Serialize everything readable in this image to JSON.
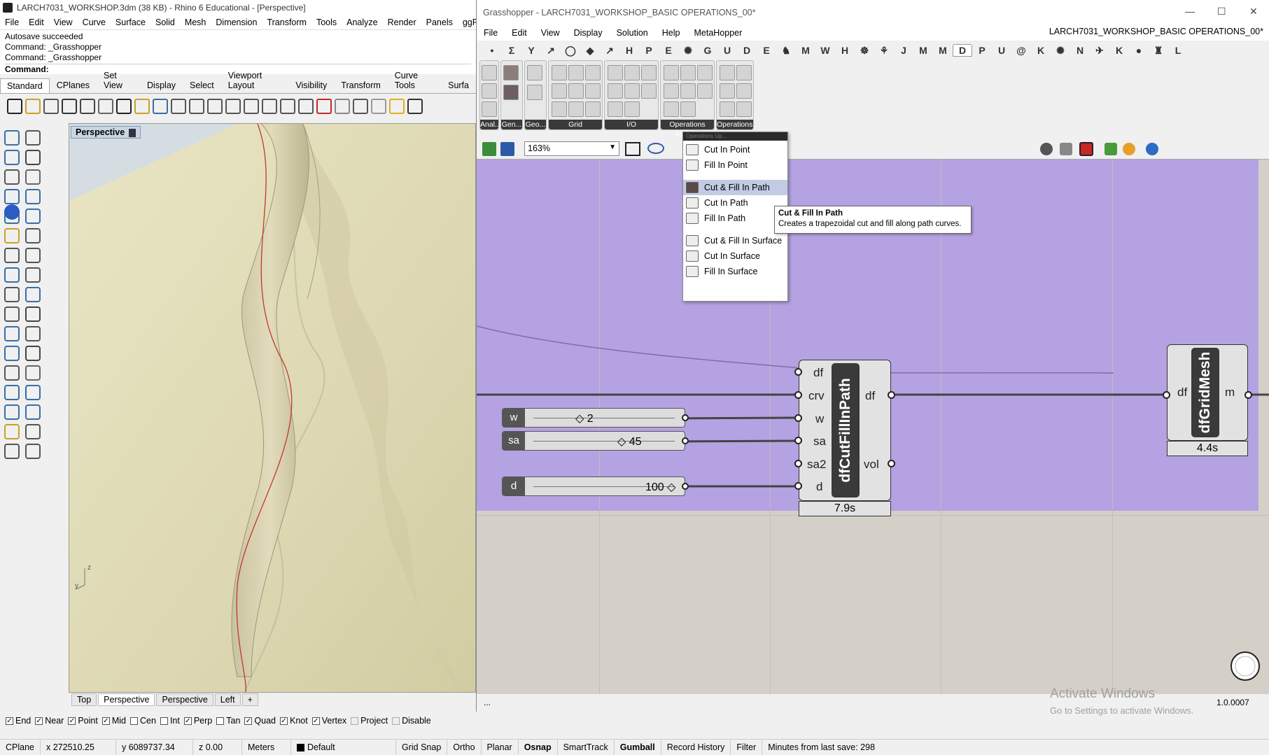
{
  "rhino": {
    "title": "LARCH7031_WORKSHOP.3dm (38 KB) - Rhino 6 Educational - [Perspective]",
    "menu": [
      "File",
      "Edit",
      "View",
      "Curve",
      "Surface",
      "Solid",
      "Mesh",
      "Dimension",
      "Transform",
      "Tools",
      "Analyze",
      "Render",
      "Panels",
      "ggRhinoIF"
    ],
    "command_history": [
      "Autosave succeeded",
      "Command: _Grasshopper",
      "Command: _Grasshopper"
    ],
    "command_prompt": "Command:",
    "toolbar_tabs": [
      "Standard",
      "CPlanes",
      "Set View",
      "Display",
      "Select",
      "Viewport Layout",
      "Visibility",
      "Transform",
      "Curve Tools",
      "Surfa"
    ],
    "active_toolbar_tab": "Standard",
    "viewport_name": "Perspective",
    "viewport_tabs": [
      "Top",
      "Perspective",
      "Perspective",
      "Left"
    ],
    "axis_labels": {
      "z": "z",
      "y": "y"
    },
    "osnaps": [
      {
        "label": "End",
        "checked": true
      },
      {
        "label": "Near",
        "checked": true
      },
      {
        "label": "Point",
        "checked": true
      },
      {
        "label": "Mid",
        "checked": true
      },
      {
        "label": "Cen",
        "checked": false
      },
      {
        "label": "Int",
        "checked": false
      },
      {
        "label": "Perp",
        "checked": true
      },
      {
        "label": "Tan",
        "checked": false
      },
      {
        "label": "Quad",
        "checked": true
      },
      {
        "label": "Knot",
        "checked": true
      },
      {
        "label": "Vertex",
        "checked": true
      },
      {
        "label": "Project",
        "checked": false
      },
      {
        "label": "Disable",
        "checked": false
      }
    ]
  },
  "status": {
    "cplane": "CPlane",
    "x": "x 272510.25",
    "y": "y 6089737.34",
    "z": "z 0.00",
    "units": "Meters",
    "layer": "Default",
    "toggles": [
      "Grid Snap",
      "Ortho",
      "Planar",
      "Osnap",
      "SmartTrack",
      "Gumball",
      "Record History",
      "Filter"
    ],
    "last_save": "Minutes from last save: 298"
  },
  "grasshopper": {
    "title": "Grasshopper - LARCH7031_WORKSHOP_BASIC OPERATIONS_00*",
    "document_name": "LARCH7031_WORKSHOP_BASIC OPERATIONS_00*",
    "menu": [
      "File",
      "Edit",
      "View",
      "Display",
      "Solution",
      "Help",
      "MetaHopper"
    ],
    "tabs": [
      "•",
      "Σ",
      "Y",
      "↗",
      "◯",
      "◆",
      "↗",
      "H",
      "P",
      "E",
      "✺",
      "G",
      "U",
      "D",
      "E",
      "♞",
      "M",
      "W",
      "H",
      "☸",
      "⚘",
      "J",
      "M",
      "M",
      "D",
      "P",
      "U",
      "@",
      "K",
      "✺",
      "N",
      "✈",
      "K",
      "●",
      "♜",
      "L"
    ],
    "active_tab_index": 24,
    "ribbon_groups": [
      "Anal...",
      "Gen...",
      "Geo...",
      "Grid",
      "I/O",
      "Operations Absol...",
      "Operations..."
    ],
    "zoom": "163%",
    "dropdown_header": "Operations Up...",
    "dropdown_items": [
      "Cut In Point",
      "Fill In Point",
      "Cut & Fill In Path",
      "Cut In Path",
      "Fill In Path",
      "Cut & Fill In Surface",
      "Cut In Surface",
      "Fill In Surface"
    ],
    "highlighted_item": "Cut & Fill In Path",
    "tooltip": {
      "title": "Cut & Fill In Path",
      "description": "Creates a trapezoidal cut and fill along path curves."
    },
    "sliders": [
      {
        "name": "w",
        "value": "2"
      },
      {
        "name": "sa",
        "value": "45"
      },
      {
        "name": "d",
        "value": "100"
      }
    ],
    "component_cutfill": {
      "name": "dfCutFillInPath",
      "inputs": [
        "df",
        "crv",
        "w",
        "sa",
        "sa2",
        "d"
      ],
      "outputs": [
        "df",
        "vol"
      ],
      "time": "7.9s"
    },
    "component_gridmesh": {
      "name": "dfGridMesh",
      "inputs": [
        "df"
      ],
      "outputs": [
        "m"
      ],
      "time": "4.4s"
    },
    "footer": "...",
    "version": "1.0.0007",
    "watermark_title": "Activate Windows",
    "watermark_sub": "Go to Settings to activate Windows."
  }
}
